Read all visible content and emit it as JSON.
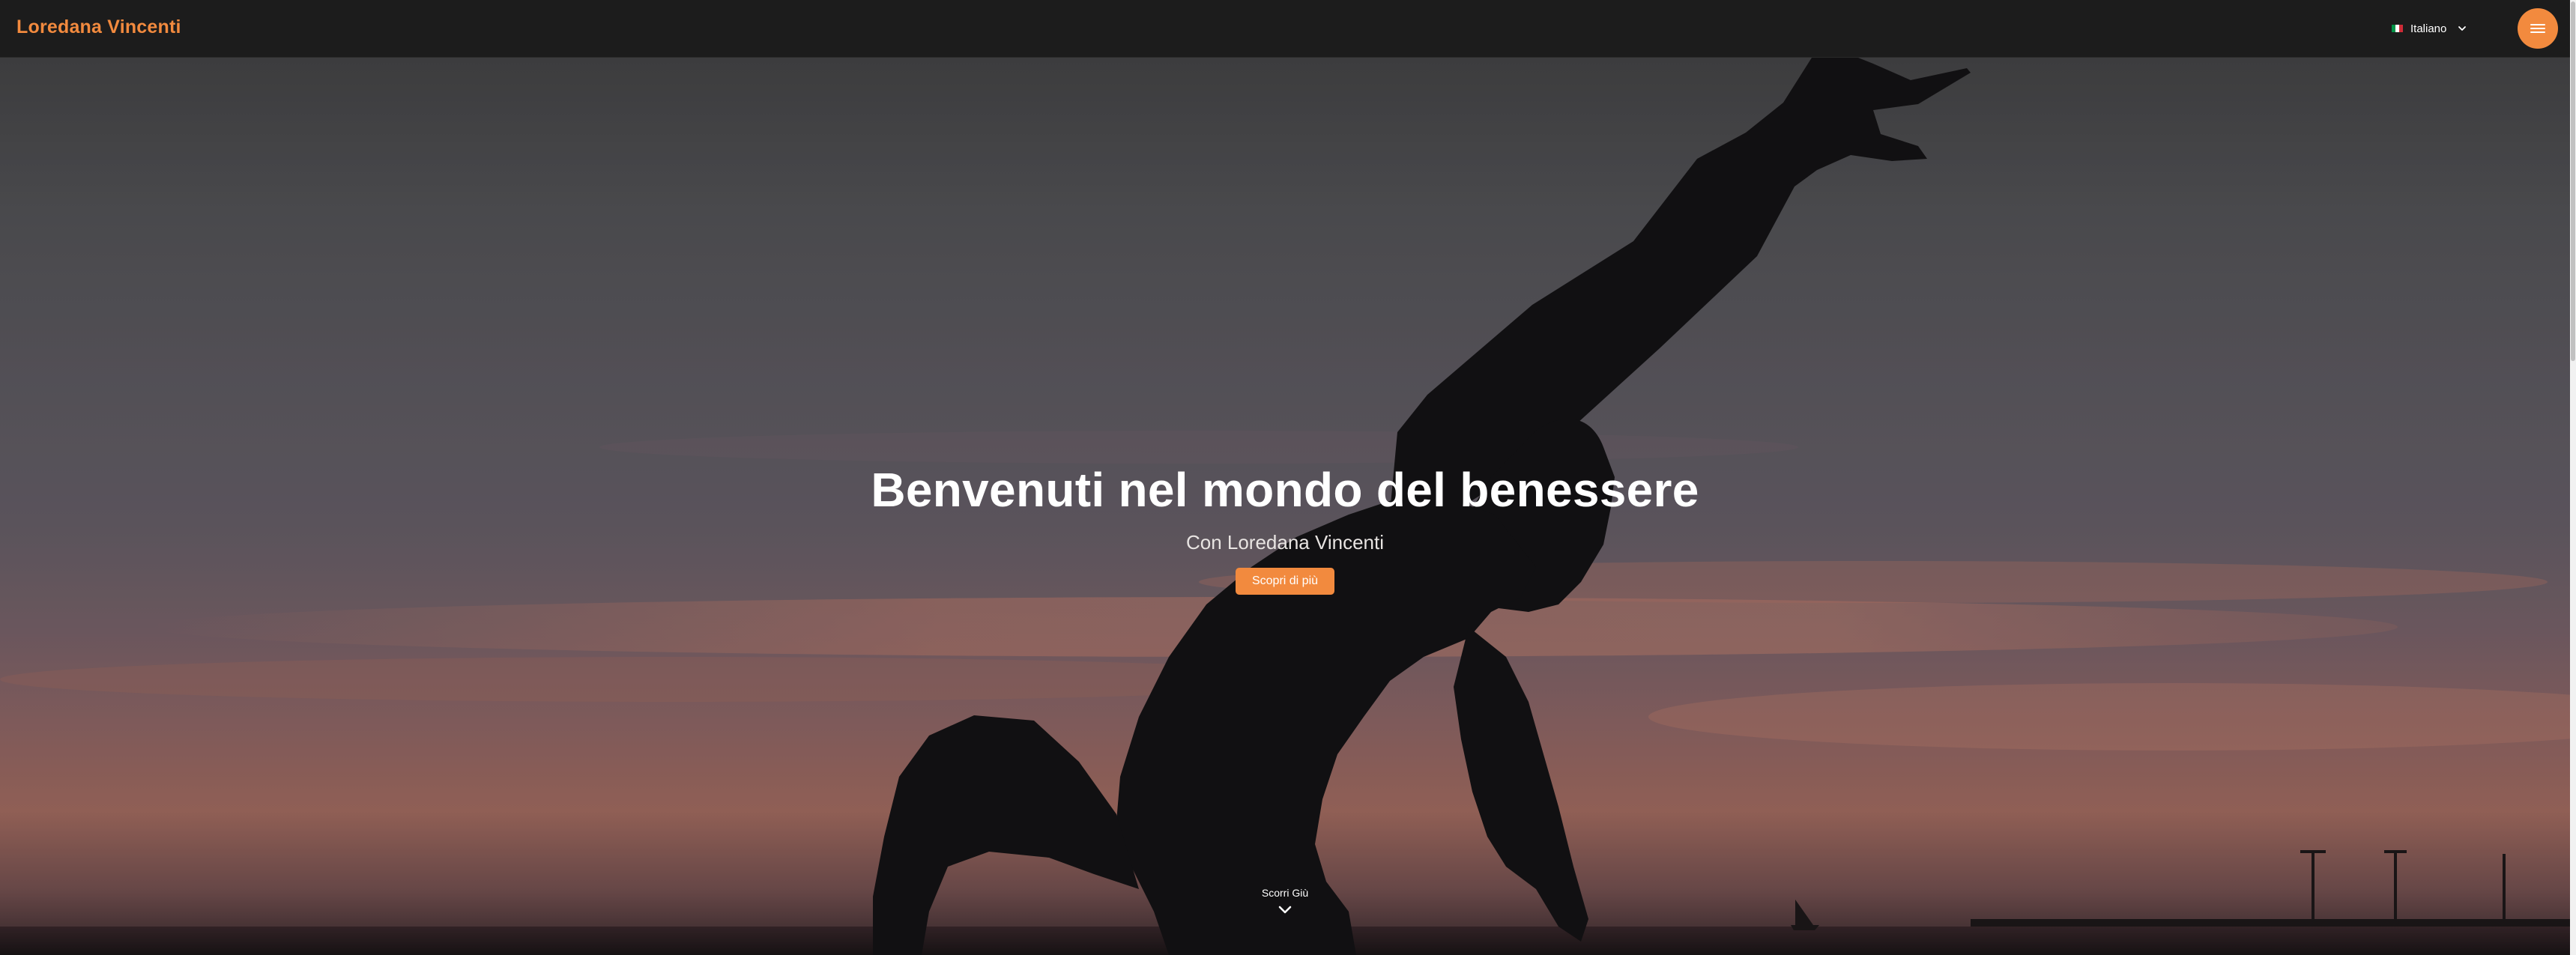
{
  "header": {
    "brand": "Loredana Vincenti",
    "language": {
      "selected": "Italiano",
      "flag_colors": [
        "#009246",
        "#ffffff",
        "#ce2b37"
      ]
    },
    "menu_icon": "hamburger-icon"
  },
  "hero": {
    "title": "Benvenuti nel mondo del benessere",
    "subtitle": "Con Loredana Vincenti",
    "cta_label": "Scopri di più",
    "scroll_label": "Scorri Giù",
    "scroll_icon": "chevron-down-icon"
  },
  "colors": {
    "accent": "#f28a3e",
    "header_bg": "#1c1c1c",
    "text_light": "#ffffff"
  }
}
